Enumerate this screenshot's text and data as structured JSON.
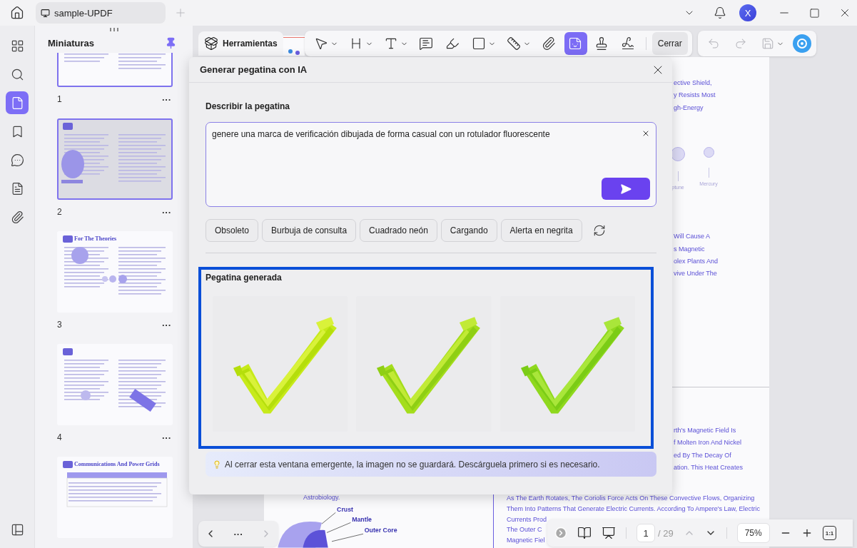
{
  "titlebar": {
    "tab": {
      "title": "sample-UPDF",
      "selected": true
    },
    "avatar": "X"
  },
  "rail": [
    {
      "kind": "thumbnails",
      "selected": false
    },
    {
      "kind": "search",
      "selected": false
    },
    {
      "kind": "pages",
      "selected": true
    },
    {
      "kind": "bookmarks",
      "selected": false
    },
    {
      "kind": "comments",
      "selected": false
    },
    {
      "kind": "forms",
      "selected": false
    },
    {
      "kind": "attachments",
      "selected": false
    }
  ],
  "rail_bottom": [
    {
      "kind": "layers",
      "selected": false
    }
  ],
  "thumbnails": {
    "title": "Miniaturas",
    "pinned": true,
    "pages": [
      {
        "number": "1",
        "menu": "···",
        "selected": false,
        "in_view": true,
        "kind": "diagram"
      },
      {
        "number": "2",
        "menu": "···",
        "selected": true,
        "in_view": true,
        "kind": "earth"
      },
      {
        "number": "3",
        "menu": "···",
        "selected": false,
        "in_view": false,
        "kind": "theories",
        "title": "For The Theories"
      },
      {
        "number": "4",
        "menu": "···",
        "selected": false,
        "in_view": false,
        "kind": "satellite"
      },
      {
        "selected": false,
        "in_view": false,
        "kind": "table",
        "title": "Communications And Power Grids"
      }
    ]
  },
  "toolbar": {
    "tools_button": "Herramientas",
    "tools": [
      {
        "kind": "select",
        "selected": false
      },
      {
        "kind": "heading",
        "selected": false
      },
      {
        "kind": "text",
        "selected": false
      },
      {
        "kind": "comment",
        "selected": false
      },
      {
        "kind": "highlight",
        "selected": false
      },
      {
        "kind": "shape",
        "selected": false
      },
      {
        "kind": "measure",
        "selected": false
      },
      {
        "kind": "attach",
        "selected": false
      },
      {
        "kind": "sticker",
        "selected": true
      },
      {
        "kind": "stamp",
        "selected": false
      },
      {
        "kind": "signature",
        "selected": false
      }
    ],
    "close": "Cerrar",
    "history": [
      {
        "kind": "undo",
        "disabled": true
      },
      {
        "kind": "redo",
        "disabled": true
      },
      {
        "kind": "save",
        "disabled": true
      }
    ]
  },
  "document": {
    "left_column": {
      "lines": [
        "Astrobiology."
      ],
      "diagram_labels": [
        "Crust",
        "Mantle",
        "Outer Core"
      ]
    },
    "right_column": {
      "top_lines": [
        "ective Shield,",
        "y Resists Most",
        "gh-Energy"
      ],
      "planet_labels": [
        "ptune",
        "Mercury"
      ],
      "middle_lines": [
        "Will Cause A",
        "s Magnetic",
        "olex Plants And",
        "vive Under The"
      ],
      "lower_lines": [
        "rth's Magnetic Field Is",
        "f Molten Iron And Nickel",
        "ed By The Decay Of",
        "ation. This Heat Creates"
      ],
      "bottom_lines": [
        "As The Earth Rotates, The Coriolis Force Acts On These Convective Flows, Organizing",
        "Them Into Patterns That Generate Electric Currents. According To Ampere's Law, Electric",
        "Currents Prod",
        "The Outer C",
        "Magnetic Fiel"
      ]
    }
  },
  "dialog": {
    "title": "Generar pegatina con IA",
    "prompt_label": "Describir la pegatina",
    "prompt": "genere una marca de verificación dibujada de forma casual con un rotulador fluorescente",
    "suggestions": [
      "Obsoleto",
      "Burbuja de consulta",
      "Cuadrado neón",
      "Cargando",
      "Alerta en negrita"
    ],
    "result_label": "Pegatina generada",
    "outlined": true,
    "notice": "Al cerrar esta ventana emergente, la imagen no se guardará. Descárguela primero si es necesario."
  },
  "footer": {
    "more": "···",
    "prev_disabled": false,
    "next_disabled": true,
    "page": "1",
    "total": "/ 29",
    "prev_page_disabled": true,
    "next_page_disabled": false,
    "zoom": "75%",
    "actual_size": "1:1"
  }
}
